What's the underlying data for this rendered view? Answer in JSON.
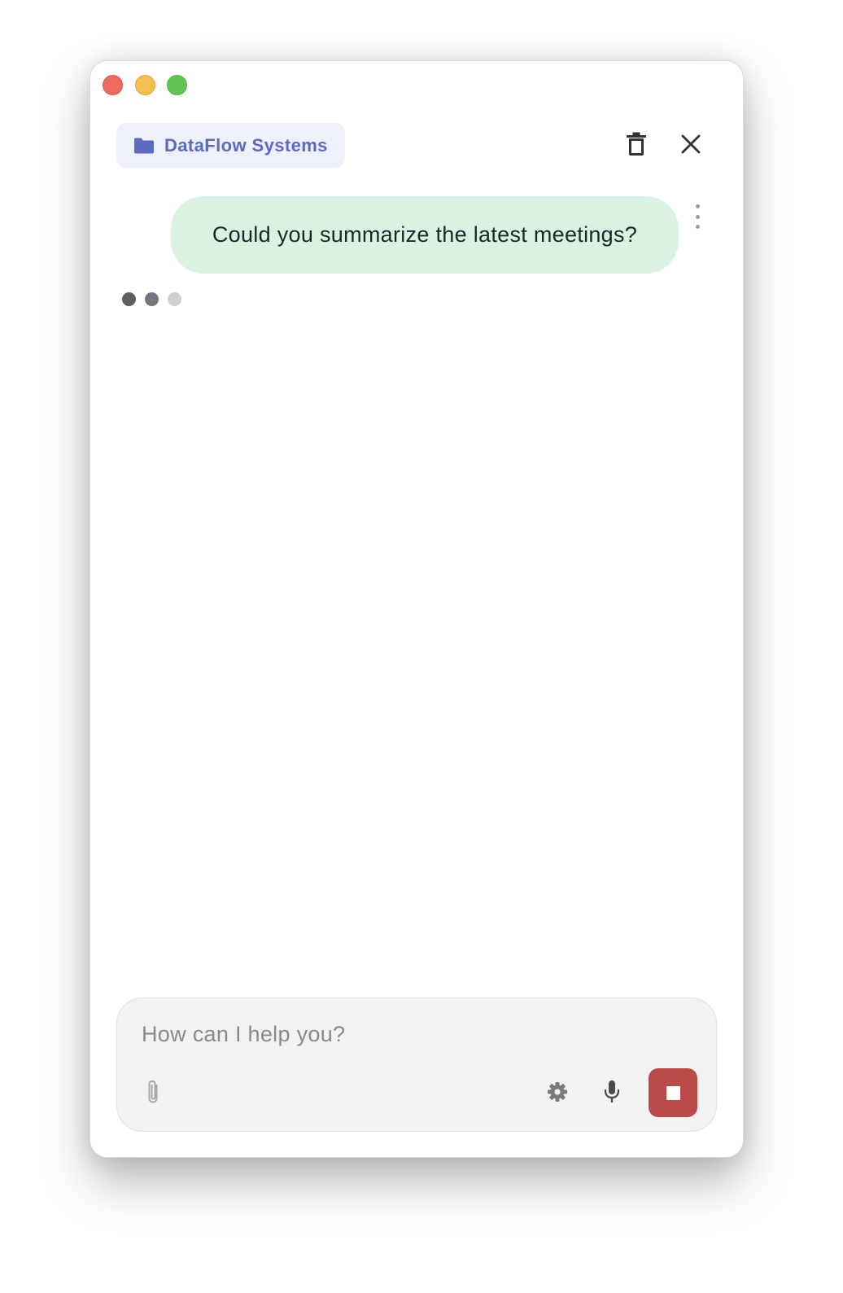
{
  "window": {
    "controls": [
      "close",
      "minimize",
      "zoom"
    ]
  },
  "header": {
    "project_name": "DataFlow Systems",
    "project_icon": "folder-icon",
    "actions": [
      {
        "name": "delete",
        "icon": "trash-icon"
      },
      {
        "name": "close",
        "icon": "close-icon"
      }
    ]
  },
  "conversation": {
    "messages": [
      {
        "role": "user",
        "text": "Could you summarize the latest meetings?"
      }
    ],
    "assistant_typing": true,
    "typing_dot_colors": [
      "#5f5f5f",
      "#767680",
      "#d0d0d0"
    ]
  },
  "composer": {
    "placeholder": "How can I help you?",
    "value": "",
    "tools": [
      {
        "name": "attach",
        "icon": "paperclip-icon"
      },
      {
        "name": "settings",
        "icon": "gear-icon"
      },
      {
        "name": "voice",
        "icon": "microphone-icon"
      },
      {
        "name": "stop",
        "icon": "stop-icon"
      }
    ]
  },
  "colors": {
    "chip_background": "#eef0fb",
    "chip_text": "#5c6bc0",
    "user_bubble": "#d9f2e2",
    "stop_button": "#b94a48",
    "composer_background": "#f2f2f2"
  }
}
